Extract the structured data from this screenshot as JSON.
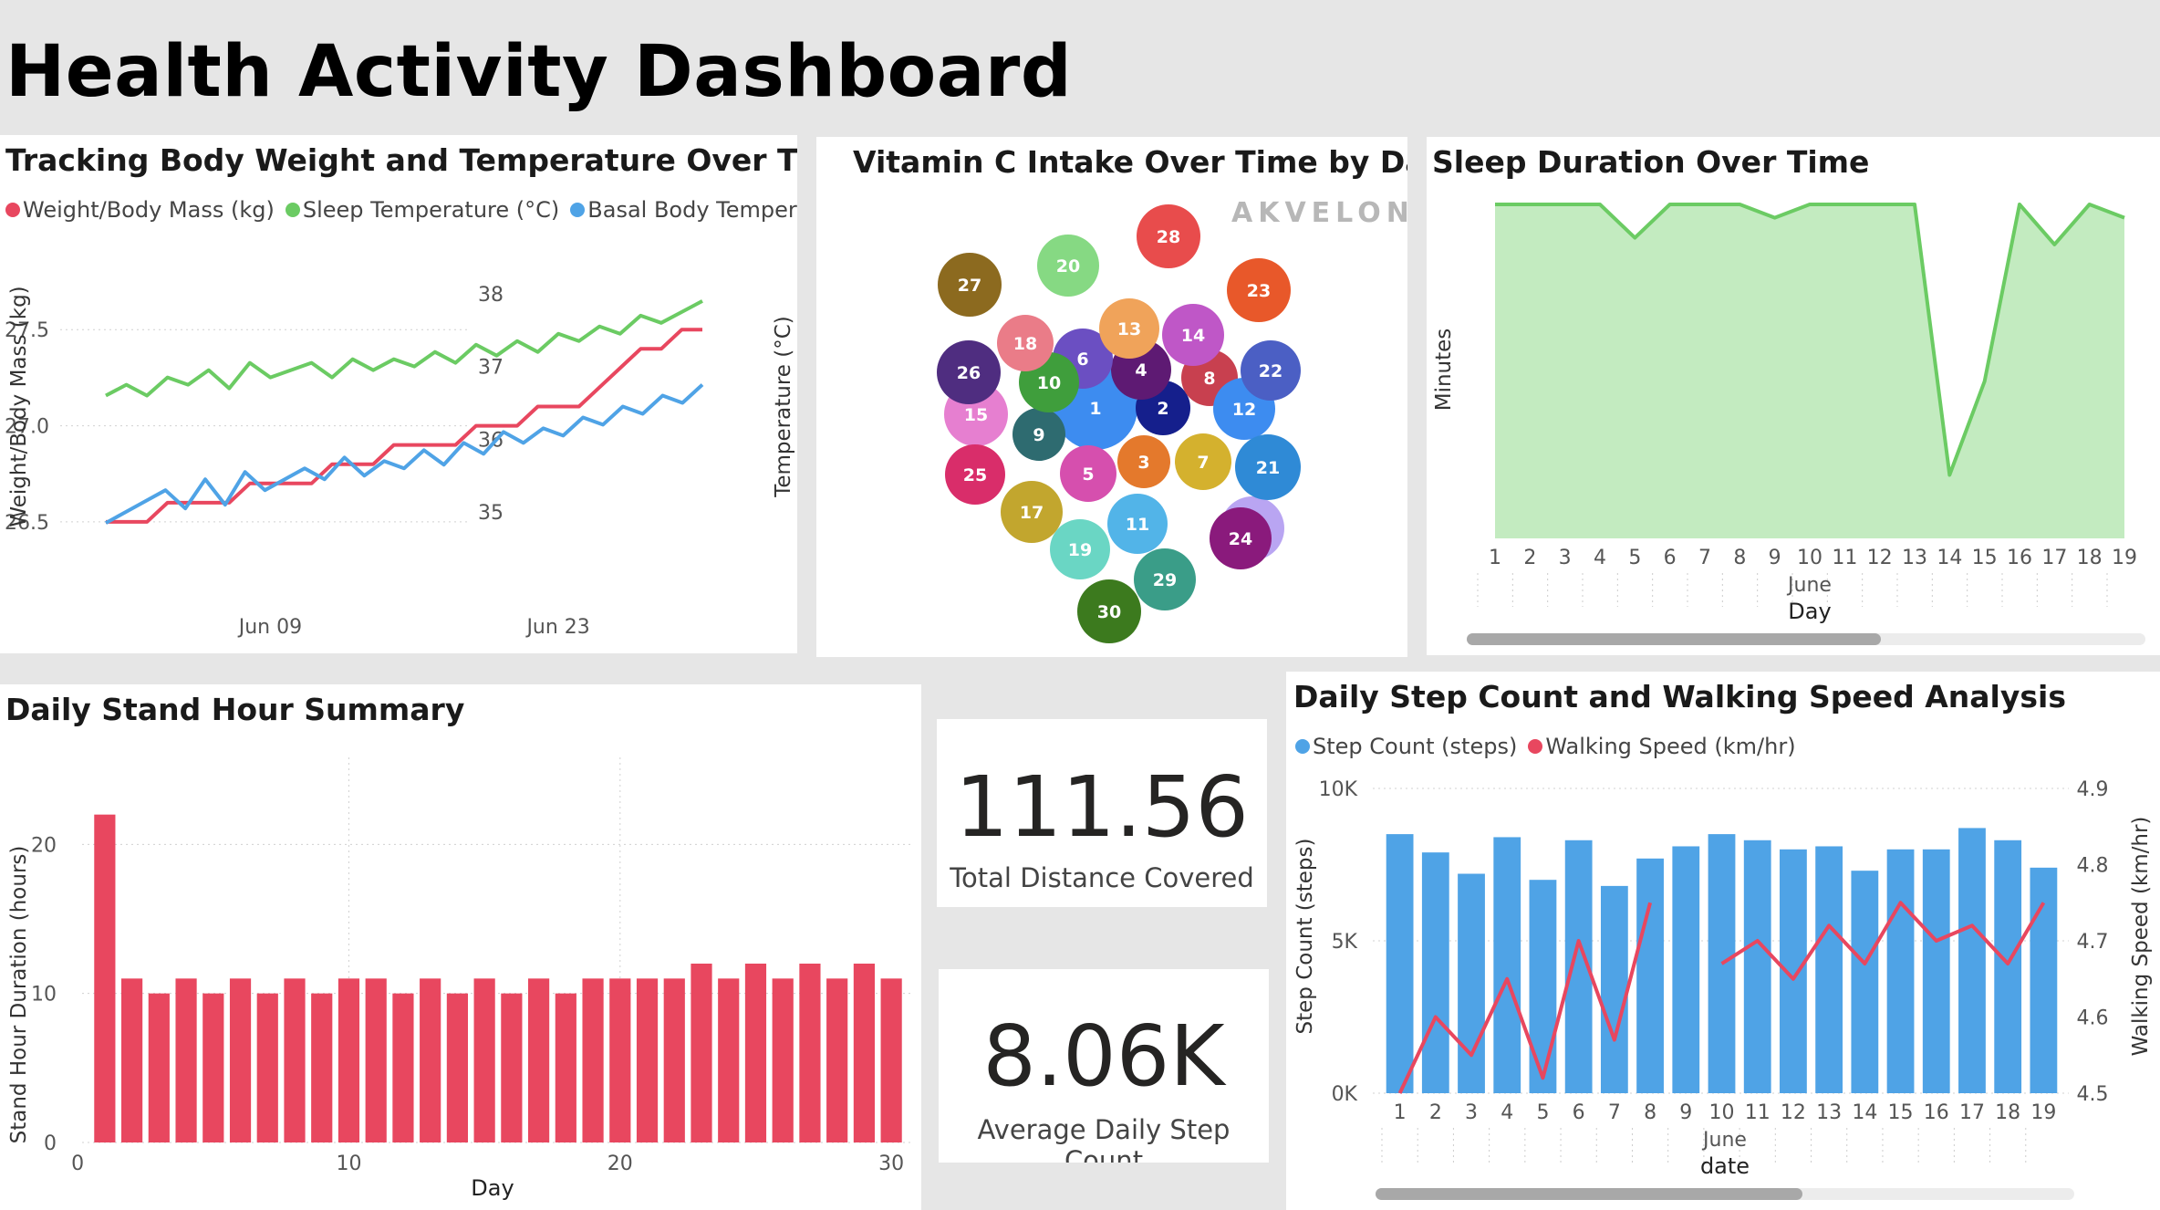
{
  "dashboard": {
    "title": "Health Activity Dashboard"
  },
  "colors": {
    "red": "#e8475f",
    "green": "#6bcb63",
    "blue": "#4fa3e6",
    "bar_blue": "#4fa3e6",
    "bar_red": "#e8475f",
    "area_green": "#c3ebc0",
    "line_green": "#6bcb63"
  },
  "weight_temp": {
    "title": "Tracking Body Weight and Temperature Over Time",
    "legend": [
      {
        "label": "Weight/Body Mass (kg)",
        "color": "#e8475f"
      },
      {
        "label": "Sleep Temperature (°C)",
        "color": "#6bcb63"
      },
      {
        "label": "Basal Body Temperat...",
        "color": "#4fa3e6"
      }
    ]
  },
  "vitamin_c": {
    "title": "Vitamin C Intake Over Time by Day",
    "logo": "AKVELON"
  },
  "sleep": {
    "title": "Sleep Duration Over Time"
  },
  "stand": {
    "title": "Daily Stand Hour Summary"
  },
  "cards": {
    "distance": {
      "value": "111.56",
      "label": "Total Distance Covered"
    },
    "steps": {
      "value": "8.06K",
      "label": "Average Daily Step Count"
    }
  },
  "steps_speed": {
    "title": "Daily Step Count and Walking Speed Analysis",
    "legend": [
      {
        "label": "Step Count (steps)",
        "color": "#4fa3e6"
      },
      {
        "label": "Walking Speed (km/hr)",
        "color": "#e8475f"
      }
    ]
  },
  "chart_data": [
    {
      "type": "line",
      "title": "Tracking Body Weight and Temperature Over Time",
      "x_tick_labels": [
        "Jun 09",
        "Jun 23"
      ],
      "x_range": [
        "Jun 01",
        "Jun 30"
      ],
      "y_left_label": "Weight/Body Mass (kg)",
      "y_left_ticks": [
        "26.5",
        "27.0",
        "27.5"
      ],
      "y_left_range": [
        26.4,
        27.8
      ],
      "y_right_label": "Temperature (°C)",
      "y_right_ticks": [
        "35",
        "36",
        "37",
        "38"
      ],
      "y_right_range": [
        34.6,
        38.3
      ],
      "grid": true,
      "series": [
        {
          "name": "Weight/Body Mass (kg)",
          "axis": "left",
          "color": "#e8475f",
          "values": [
            26.5,
            26.5,
            26.5,
            26.6,
            26.6,
            26.6,
            26.6,
            26.7,
            26.7,
            26.7,
            26.7,
            26.8,
            26.8,
            26.8,
            26.9,
            26.9,
            26.9,
            26.9,
            27.0,
            27.0,
            27.0,
            27.1,
            27.1,
            27.1,
            27.2,
            27.3,
            27.4,
            27.4,
            27.5,
            27.5
          ]
        },
        {
          "name": "Sleep Temperature (°C)",
          "axis": "right",
          "color": "#6bcb63",
          "values": [
            36.6,
            36.75,
            36.6,
            36.85,
            36.75,
            36.95,
            36.7,
            37.05,
            36.85,
            36.95,
            37.05,
            36.85,
            37.1,
            36.95,
            37.1,
            37.0,
            37.2,
            37.05,
            37.3,
            37.15,
            37.35,
            37.2,
            37.45,
            37.35,
            37.55,
            37.45,
            37.7,
            37.6,
            37.75,
            37.9
          ]
        },
        {
          "name": "Basal Body Temperature (°C)",
          "axis": "right",
          "color": "#4fa3e6",
          "values": [
            34.85,
            35.0,
            35.15,
            35.3,
            35.05,
            35.45,
            35.1,
            35.55,
            35.3,
            35.45,
            35.6,
            35.45,
            35.75,
            35.5,
            35.7,
            35.6,
            35.85,
            35.65,
            35.95,
            35.8,
            36.1,
            35.95,
            36.15,
            36.05,
            36.3,
            36.2,
            36.45,
            36.35,
            36.6,
            36.5,
            36.75
          ]
        }
      ]
    },
    {
      "type": "bubble",
      "title": "Vitamin C Intake Over Time by Day",
      "days": [
        "1",
        "2",
        "3",
        "4",
        "5",
        "6",
        "7",
        "8",
        "9",
        "10",
        "11",
        "12",
        "13",
        "14",
        "15",
        "16",
        "17",
        "18",
        "19",
        "20",
        "21",
        "22",
        "23",
        "24",
        "25",
        "26",
        "27",
        "28",
        "29",
        "30"
      ],
      "colors": [
        "#3d8cf0",
        "#151f8c",
        "#e4792c",
        "#5e1a73",
        "#d64fae",
        "#6b4fc2",
        "#d4b12e",
        "#c8404f",
        "#2e6b70",
        "#3f9e3c",
        "#52b4e8",
        "#3d8cf0",
        "#f0a35a",
        "#bf57c7",
        "#e67fd0",
        "#b9a5f2",
        "#c2a62e",
        "#ea7c88",
        "#6ad6c4",
        "#86d983",
        "#2f8ad6",
        "#4b5fc4",
        "#e8582a",
        "#8a1a7c",
        "#d92d6a",
        "#4f2d80",
        "#8c6a1f",
        "#e84c4c",
        "#3a9d88",
        "#3c7a1e"
      ]
    },
    {
      "type": "area",
      "title": "Sleep Duration Over Time",
      "x": [
        "1",
        "2",
        "3",
        "4",
        "5",
        "6",
        "7",
        "8",
        "9",
        "10",
        "11",
        "12",
        "13",
        "14",
        "15",
        "16",
        "17",
        "18",
        "19"
      ],
      "x_group_label": "June",
      "xlabel": "Day",
      "ylabel": "Minutes",
      "values": [
        100,
        100,
        100,
        100,
        90,
        100,
        100,
        100,
        96,
        100,
        100,
        100,
        100,
        19,
        47,
        100,
        88,
        100,
        96
      ]
    },
    {
      "type": "bar",
      "title": "Daily Stand Hour Summary",
      "xlabel": "Day",
      "ylabel": "Stand Hour Duration (hours)",
      "x_ticks": [
        "0",
        "10",
        "20",
        "30"
      ],
      "y_ticks": [
        "0",
        "10",
        "20"
      ],
      "ylim": [
        0,
        24
      ],
      "categories": [
        1,
        2,
        3,
        4,
        5,
        6,
        7,
        8,
        9,
        10,
        11,
        12,
        13,
        14,
        15,
        16,
        17,
        18,
        19,
        20,
        21,
        22,
        23,
        24,
        25,
        26,
        27,
        28,
        29,
        30
      ],
      "values": [
        22,
        11,
        10,
        11,
        10,
        11,
        10,
        11,
        10,
        11,
        11,
        10,
        11,
        10,
        11,
        10,
        11,
        10,
        11,
        11,
        11,
        11,
        12,
        11,
        12,
        11,
        12,
        11,
        12,
        11
      ]
    },
    {
      "type": "bar",
      "title": "Daily Step Count and Walking Speed Analysis",
      "xlabel": "date",
      "x_group_label": "June",
      "categories": [
        "1",
        "2",
        "3",
        "4",
        "5",
        "6",
        "7",
        "8",
        "9",
        "10",
        "11",
        "12",
        "13",
        "14",
        "15",
        "16",
        "17",
        "18",
        "19"
      ],
      "y_left_label": "Step Count (steps)",
      "y_left_ticks": [
        "0K",
        "5K",
        "10K"
      ],
      "y_left_range": [
        0,
        10000
      ],
      "y_right_label": "Walking Speed (km/hr)",
      "y_right_ticks": [
        "4.5",
        "4.6",
        "4.7",
        "4.8",
        "4.9"
      ],
      "y_right_range": [
        4.5,
        4.9
      ],
      "series": [
        {
          "name": "Step Count (steps)",
          "type": "bar",
          "color": "#4fa3e6",
          "values": [
            8500,
            7900,
            7200,
            8400,
            7000,
            8300,
            6800,
            7700,
            8100,
            8500,
            8300,
            8000,
            8100,
            7300,
            8000,
            8000,
            8700,
            8300,
            7400
          ]
        },
        {
          "name": "Walking Speed (km/hr)",
          "type": "line",
          "color": "#e8475f",
          "values": [
            4.5,
            4.6,
            4.55,
            4.65,
            4.52,
            4.7,
            4.57,
            4.75,
            null,
            4.67,
            4.7,
            4.65,
            4.72,
            4.67,
            4.75,
            4.7,
            4.72,
            4.67,
            4.75
          ]
        }
      ]
    }
  ]
}
